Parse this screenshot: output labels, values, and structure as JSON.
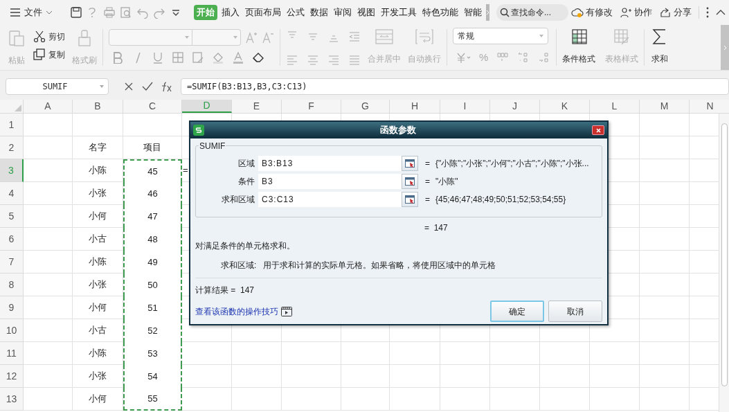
{
  "menu_bar": {
    "file_menu": "文件",
    "tabs": [
      {
        "label": "开始",
        "selected": true
      },
      {
        "label": "插入",
        "selected": false
      },
      {
        "label": "页面布局",
        "selected": false
      },
      {
        "label": "公式",
        "selected": false
      },
      {
        "label": "数据",
        "selected": false
      },
      {
        "label": "审阅",
        "selected": false
      },
      {
        "label": "视图",
        "selected": false
      },
      {
        "label": "开发工具",
        "selected": false
      },
      {
        "label": "特色功能",
        "selected": false
      },
      {
        "label": "智能",
        "selected": false
      }
    ],
    "search": {
      "placeholder": "查找命令..."
    },
    "actions": [
      "有修改",
      "协作",
      "分享"
    ]
  },
  "ribbon": {
    "paste": {
      "label": "粘贴",
      "disabled": true
    },
    "cut": {
      "label": "剪切",
      "disabled": false
    },
    "copy": {
      "label": "复制",
      "disabled": false
    },
    "format_painter": {
      "label": "格式刷",
      "disabled": true
    },
    "merge_center": {
      "label": "合并居中",
      "disabled": true
    },
    "wrap_text": {
      "label": "自动换行",
      "disabled": true
    },
    "number_format": "常规",
    "percent": "%",
    "conditional_format": {
      "label": "条件格式",
      "disabled": false
    },
    "table_style": {
      "label": "表格样式",
      "disabled": true
    },
    "sum": {
      "label": "求和",
      "disabled": false
    }
  },
  "formula_bar": {
    "name_box": "SUMIF",
    "formula": "=SUMIF(B3:B13,B3,C3:C13)"
  },
  "sheet": {
    "columns": [
      {
        "label": "A",
        "selected": false
      },
      {
        "label": "B",
        "selected": false
      },
      {
        "label": "C",
        "selected": false
      },
      {
        "label": "D",
        "selected": true
      },
      {
        "label": "E",
        "selected": false
      },
      {
        "label": "F",
        "selected": false
      },
      {
        "label": "G",
        "selected": false
      },
      {
        "label": "H",
        "selected": false
      },
      {
        "label": "I",
        "selected": false
      },
      {
        "label": "J",
        "selected": false
      },
      {
        "label": "K",
        "selected": false
      },
      {
        "label": "L",
        "selected": false
      },
      {
        "label": "M",
        "selected": false
      },
      {
        "label": "N",
        "selected": false
      }
    ],
    "rows": [
      {
        "number": "1",
        "selected": false,
        "cells": {}
      },
      {
        "number": "2",
        "selected": false,
        "cells": {
          "B": {
            "text": "名字"
          },
          "C": {
            "text": "项目"
          }
        }
      },
      {
        "number": "3",
        "selected": true,
        "cells": {
          "B": {
            "text": "小陈"
          },
          "C": {
            "text": "45",
            "marquee": true
          },
          "D": {
            "text": "="
          }
        }
      },
      {
        "number": "4",
        "selected": false,
        "cells": {
          "B": {
            "text": "小张"
          },
          "C": {
            "text": "46",
            "marquee": true
          }
        }
      },
      {
        "number": "5",
        "selected": false,
        "cells": {
          "B": {
            "text": "小何"
          },
          "C": {
            "text": "47",
            "marquee": true
          }
        }
      },
      {
        "number": "6",
        "selected": false,
        "cells": {
          "B": {
            "text": "小古"
          },
          "C": {
            "text": "48",
            "marquee": true
          }
        }
      },
      {
        "number": "7",
        "selected": false,
        "cells": {
          "B": {
            "text": "小陈"
          },
          "C": {
            "text": "49",
            "marquee": true
          }
        }
      },
      {
        "number": "8",
        "selected": false,
        "cells": {
          "B": {
            "text": "小张"
          },
          "C": {
            "text": "50",
            "marquee": true
          }
        }
      },
      {
        "number": "9",
        "selected": false,
        "cells": {
          "B": {
            "text": "小何"
          },
          "C": {
            "text": "51",
            "marquee": true
          }
        }
      },
      {
        "number": "10",
        "selected": false,
        "cells": {
          "B": {
            "text": "小古"
          },
          "C": {
            "text": "52",
            "marquee": true
          }
        }
      },
      {
        "number": "11",
        "selected": false,
        "cells": {
          "B": {
            "text": "小陈"
          },
          "C": {
            "text": "53",
            "marquee": true
          }
        }
      },
      {
        "number": "12",
        "selected": false,
        "cells": {
          "B": {
            "text": "小张"
          },
          "C": {
            "text": "54",
            "marquee": true
          }
        }
      },
      {
        "number": "13",
        "selected": false,
        "cells": {
          "B": {
            "text": "小何"
          },
          "C": {
            "text": "55",
            "marquee": true
          }
        }
      }
    ]
  },
  "dialog": {
    "title": "函数参数",
    "function_name": "SUMIF",
    "args": [
      {
        "label": "区域",
        "value": "B3:B13",
        "equals": "=",
        "result": "{\"小陈\";\"小张\";\"小何\";\"小古\";\"小陈\";\"小张..."
      },
      {
        "label": "条件",
        "value": "B3",
        "equals": "=",
        "result": "\"小陈\""
      },
      {
        "label": "求和区域",
        "value": "C3:C13",
        "equals": "=",
        "result": "{45;46;47;48;49;50;51;52;53;54;55}"
      }
    ],
    "formula_result": "=  147",
    "description": "对满足条件的单元格求和。",
    "arg_help_label": "求和区域:",
    "arg_help": "用于求和计算的实际单元格。如果省略，将使用区域中的单元格",
    "result_line": "计算结果 =  147",
    "help_link": "查看该函数的操作技巧",
    "buttons": [
      {
        "label": "确定",
        "default": true
      },
      {
        "label": "取消",
        "default": false
      }
    ]
  }
}
